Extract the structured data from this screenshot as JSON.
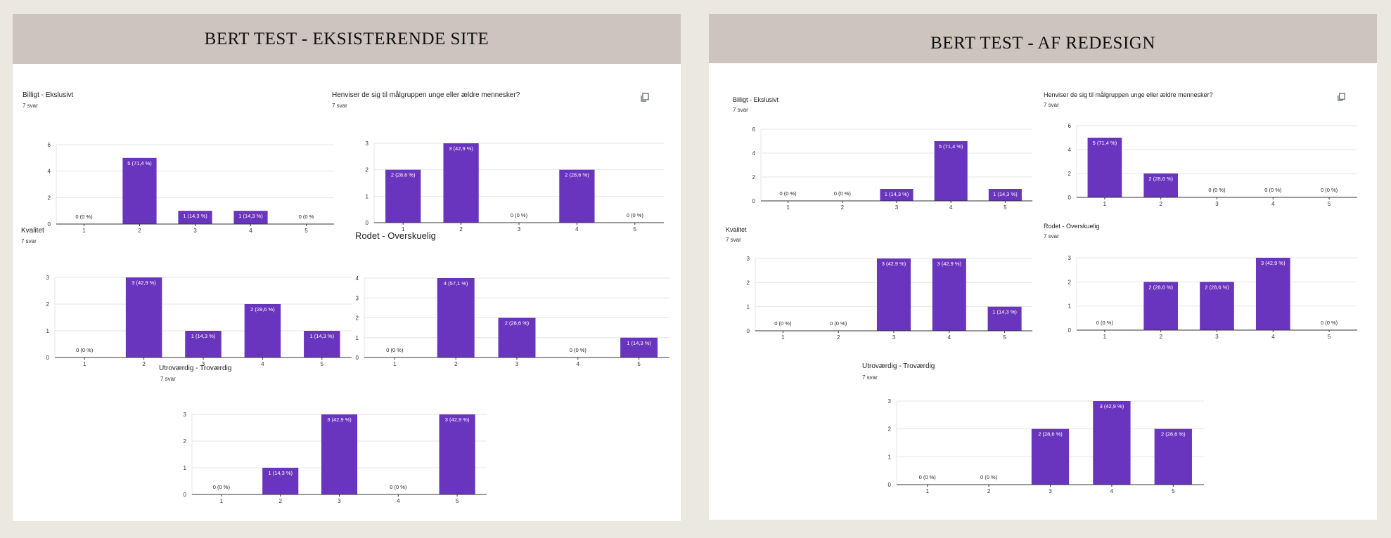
{
  "panels": [
    {
      "title": "BERT TEST - EKSISTERENDE SITE",
      "charts": [
        {
          "title": "Billigt - Ekslusivt",
          "subtitle": "7 svar",
          "copy_icon": false,
          "chart_data": {
            "type": "bar",
            "categories": [
              "1",
              "2",
              "3",
              "4",
              "5"
            ],
            "values": [
              0,
              5,
              1,
              1,
              0
            ],
            "labels": [
              "0 (0 %)",
              "5 (71,4 %)",
              "1 (14,3 %)",
              "1 (14,3 %)",
              "0 (0 %"
            ],
            "yticks": [
              0,
              2,
              4,
              6
            ],
            "ylim": [
              0,
              6
            ]
          }
        },
        {
          "title": "Henviser de sig til målgruppen unge eller ældre mennesker?",
          "subtitle": "7 svar",
          "copy_icon": true,
          "chart_data": {
            "type": "bar",
            "categories": [
              "1",
              "2",
              "3",
              "4",
              "5"
            ],
            "values": [
              2,
              3,
              0,
              2,
              0
            ],
            "labels": [
              "2 (28,6 %)",
              "3 (42,9 %)",
              "0 (0 %)",
              "2 (28,6 %)",
              "0 (0 %)"
            ],
            "yticks": [
              0,
              1,
              2,
              3
            ],
            "ylim": [
              0,
              3
            ]
          }
        },
        {
          "title": "Kvalitet",
          "subtitle": "7 svar",
          "copy_icon": false,
          "chart_data": {
            "type": "bar",
            "categories": [
              "1",
              "2",
              "3",
              "4",
              "5"
            ],
            "values": [
              0,
              3,
              1,
              2,
              1
            ],
            "labels": [
              "0 (0 %)",
              "3 (42,9 %)",
              "1 (14,3 %)",
              "2 (28,6 %)",
              "1 (14,3 %)"
            ],
            "yticks": [
              0,
              1,
              2,
              3
            ],
            "ylim": [
              0,
              3
            ]
          }
        },
        {
          "title": "Rodet - Overskuelig",
          "subtitle": "",
          "copy_icon": false,
          "chart_data": {
            "type": "bar",
            "categories": [
              "1",
              "2",
              "3",
              "4",
              "5"
            ],
            "values": [
              0,
              4,
              2,
              0,
              1
            ],
            "labels": [
              "0 (0 %)",
              "4 (57,1 %)",
              "2 (28,6 %)",
              "0 (0 %)",
              "1 (14,3 %)"
            ],
            "yticks": [
              0,
              1,
              2,
              3,
              4
            ],
            "ylim": [
              0,
              4
            ]
          }
        },
        {
          "title": "Utroværdig - Troværdig",
          "subtitle": "7 svar",
          "copy_icon": false,
          "chart_data": {
            "type": "bar",
            "categories": [
              "1",
              "2",
              "3",
              "4",
              "5"
            ],
            "values": [
              0,
              1,
              3,
              0,
              3
            ],
            "labels": [
              "0 (0 %)",
              "1 (14,3 %)",
              "3 (42,9 %)",
              "0 (0 %)",
              "3 (42,9 %)"
            ],
            "yticks": [
              0,
              1,
              2,
              3
            ],
            "ylim": [
              0,
              3
            ]
          }
        }
      ]
    },
    {
      "title": "BERT TEST - AF REDESIGN",
      "charts": [
        {
          "title": "Billigt - Ekslusivt",
          "subtitle": "7 svar",
          "copy_icon": false,
          "chart_data": {
            "type": "bar",
            "categories": [
              "1",
              "2",
              "3",
              "4",
              "5"
            ],
            "values": [
              0,
              0,
              1,
              5,
              1
            ],
            "labels": [
              "0 (0 %)",
              "0 (0 %)",
              "1 (14,3 %)",
              "5 (71,4 %)",
              "1 (14,3 %)"
            ],
            "yticks": [
              0,
              2,
              4,
              6
            ],
            "ylim": [
              0,
              6
            ]
          }
        },
        {
          "title": "Henviser de sig til målgruppen unge eller ældre mennesker?",
          "subtitle": "7 svar",
          "copy_icon": true,
          "chart_data": {
            "type": "bar",
            "categories": [
              "1",
              "2",
              "3",
              "4",
              "5"
            ],
            "values": [
              5,
              2,
              0,
              0,
              0
            ],
            "labels": [
              "5 (71,4 %)",
              "2 (28,6 %)",
              "0 (0 %)",
              "0 (0 %)",
              "0 (0 %)"
            ],
            "yticks": [
              0,
              2,
              4,
              6
            ],
            "ylim": [
              0,
              6
            ]
          }
        },
        {
          "title": "Kvalitet",
          "subtitle": "7 svar",
          "copy_icon": false,
          "chart_data": {
            "type": "bar",
            "categories": [
              "1",
              "2",
              "3",
              "4",
              "5"
            ],
            "values": [
              0,
              0,
              3,
              3,
              1
            ],
            "labels": [
              "0 (0 %)",
              "0 (0 %)",
              "3 (42,9 %)",
              "3 (42,9 %)",
              "1 (14,3 %)"
            ],
            "yticks": [
              0,
              1,
              2,
              3
            ],
            "ylim": [
              0,
              3
            ]
          }
        },
        {
          "title": "Rodet - Overskuelig",
          "subtitle": "7 svar",
          "copy_icon": false,
          "chart_data": {
            "type": "bar",
            "categories": [
              "1",
              "2",
              "3",
              "4",
              "5"
            ],
            "values": [
              0,
              2,
              2,
              3,
              0
            ],
            "labels": [
              "0 (0 %)",
              "2 (28,6 %)",
              "2 (28,6 %)",
              "3 (42,9 %)",
              "0 (0 %)"
            ],
            "yticks": [
              0,
              1,
              2,
              3
            ],
            "ylim": [
              0,
              3
            ]
          }
        },
        {
          "title": "Utroværdig - Troværdig",
          "subtitle": "7 svar",
          "copy_icon": false,
          "chart_data": {
            "type": "bar",
            "categories": [
              "1",
              "2",
              "3",
              "4",
              "5"
            ],
            "values": [
              0,
              0,
              2,
              3,
              2
            ],
            "labels": [
              "0 (0 %)",
              "0 (0 %)",
              "2 (28,6 %)",
              "3 (42,9 %)",
              "2 (28,6 %)"
            ],
            "yticks": [
              0,
              1,
              2,
              3
            ],
            "ylim": [
              0,
              3
            ]
          }
        }
      ]
    }
  ],
  "colors": {
    "bar": "#6a35be",
    "grid": "#e6e6e6",
    "axis": "#333333",
    "header": "#cdc3bf",
    "background": "#ebe7e1"
  },
  "icons": {
    "copy": "copy-icon"
  }
}
